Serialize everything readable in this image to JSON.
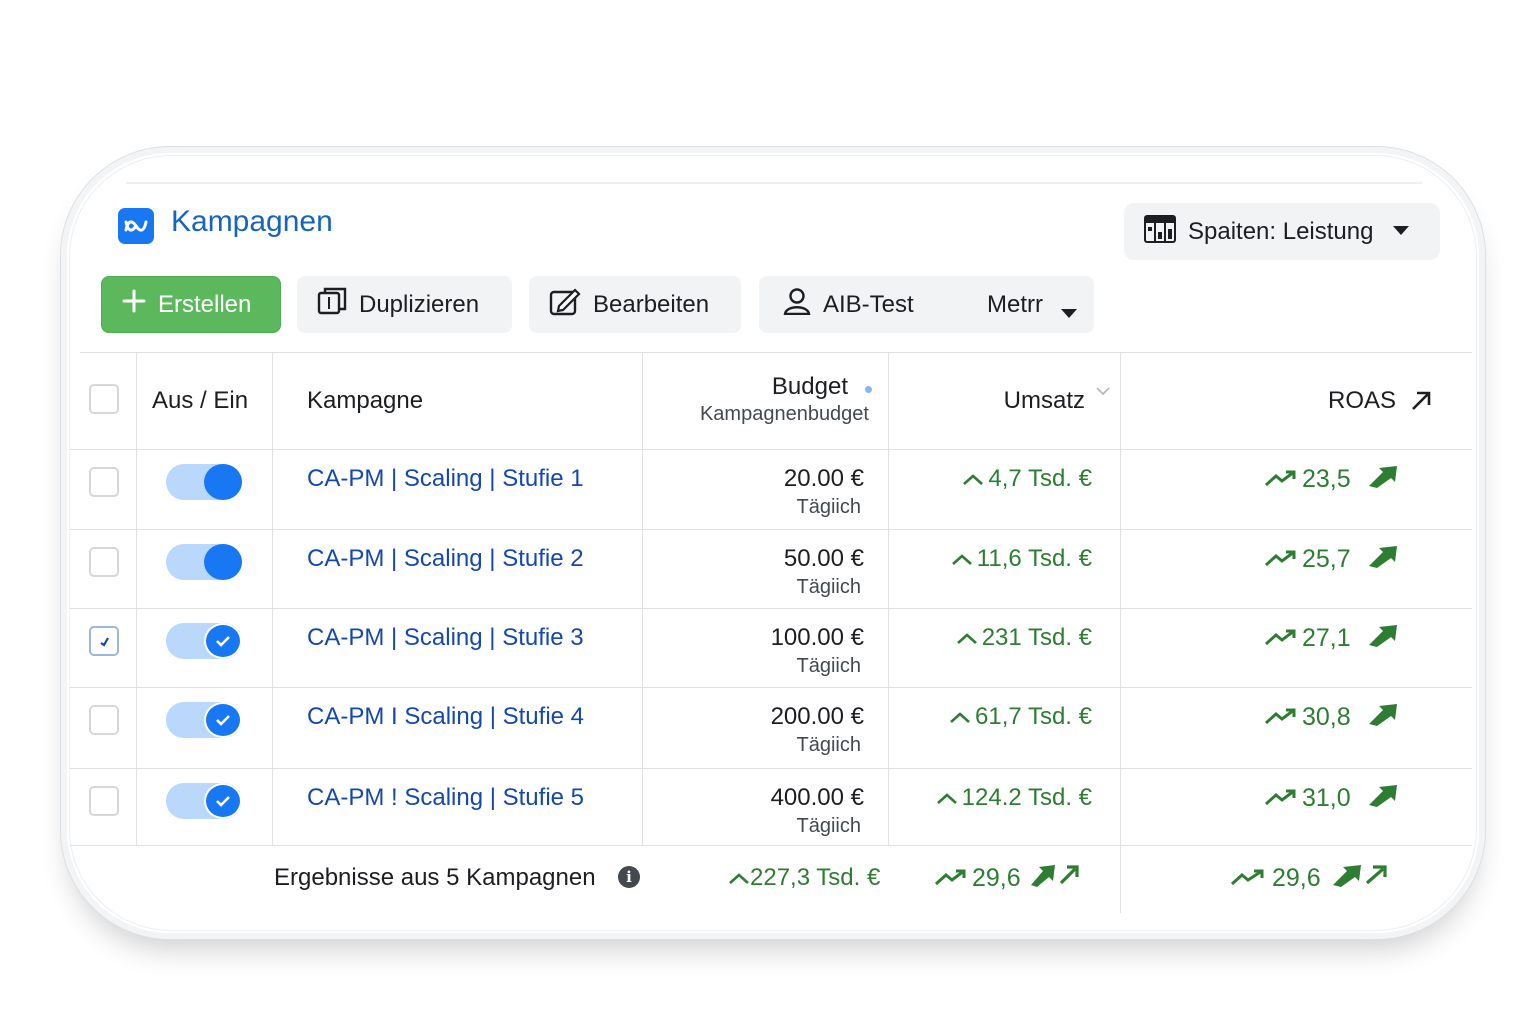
{
  "header": {
    "title": "Kampagnen",
    "logo_icon": "meta-logo-icon",
    "columns_label": "Spaiten: Leistung"
  },
  "toolbar": {
    "create_label": "Erstellen",
    "duplicate_label": "Duplizieren",
    "edit_label": "Bearbeiten",
    "ab_test_label": "AIB-Test",
    "more_label": "Metrr"
  },
  "table": {
    "headers": {
      "toggle": "Aus / Ein",
      "campaign": "Kampagne",
      "budget": "Budget",
      "budget_sub": "Kampagnenbudget",
      "revenue": "Umsatz",
      "roas": "ROAS"
    },
    "rows": [
      {
        "name": "CA-PM | Scaling | Stufie 1",
        "budget": "20.00 €",
        "budget_period": "Tägiich",
        "revenue": "4,7 Tsd. €",
        "roas": "23,5",
        "checked": false,
        "on": true
      },
      {
        "name": "CA-PM | Scaling | Stufie 2",
        "budget": "50.00 €",
        "budget_period": "Tägiich",
        "revenue": "11,6 Tsd. €",
        "roas": "25,7",
        "checked": false,
        "on": true
      },
      {
        "name": "CA-PM | Scaling | Stufie 3",
        "budget": "100.00 €",
        "budget_period": "Tägiich",
        "revenue": "231 Tsd. €",
        "roas": "27,1",
        "checked": true,
        "on": true
      },
      {
        "name": "CA-PM I Scaling | Stufie 4",
        "budget": "200.00 €",
        "budget_period": "Tägiich",
        "revenue": "61,7 Tsd. €",
        "roas": "30,8",
        "checked": false,
        "on": true
      },
      {
        "name": "CA-PM ! Scaling | Stufie 5",
        "budget": "400.00 €",
        "budget_period": "Tägiich",
        "revenue": "124.2 Tsd. €",
        "roas": "31,0",
        "checked": false,
        "on": true
      }
    ],
    "footer": {
      "label": "Ergebnisse aus 5 Kampagnen",
      "revenue": "227,3 Tsd. €",
      "roas_mid": "29,6",
      "roas": "29,6"
    }
  },
  "colors": {
    "accent": "#1877f2",
    "link": "#1547b0",
    "positive": "#2e7d32",
    "create": "#5cb85c"
  }
}
